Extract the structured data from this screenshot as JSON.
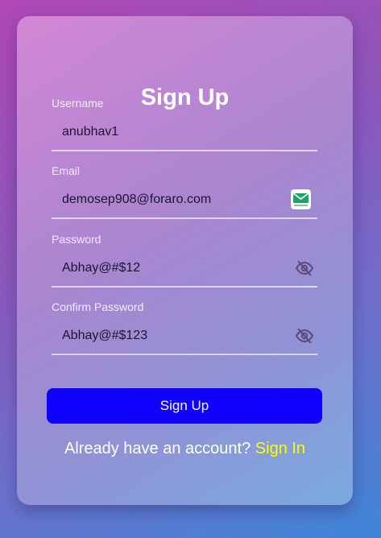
{
  "form": {
    "title": "Sign Up",
    "username": {
      "label": "Username",
      "value": "anubhav1"
    },
    "email": {
      "label": "Email",
      "value": "demosep908@foraro.com",
      "icon": "temp-mail-icon"
    },
    "password": {
      "label": "Password",
      "value": "Abhay@#$12",
      "icon": "eye-off-icon"
    },
    "confirm_password": {
      "label": "Confirm Password",
      "value": "Abhay@#$123",
      "icon": "eye-off-icon"
    },
    "submit_label": "Sign Up",
    "footer_text": "Already have an account?",
    "signin_label": "Sign In"
  },
  "colors": {
    "button": "#1000ff",
    "signin_link": "#ffff00",
    "title": "#ffffff"
  }
}
